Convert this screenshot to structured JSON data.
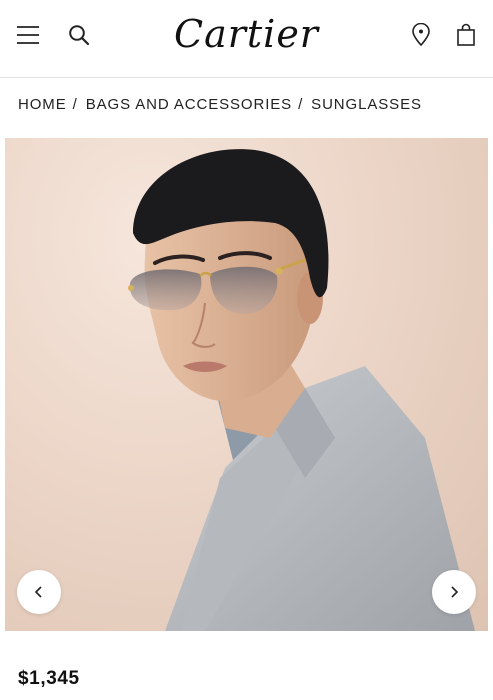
{
  "header": {
    "logo_text": "Cartier",
    "icons": [
      "menu-icon",
      "search-icon",
      "location-pin-icon",
      "shopping-bag-icon"
    ]
  },
  "breadcrumb": {
    "items": [
      "HOME",
      "BAGS AND ACCESSORIES",
      "SUNGLASSES"
    ],
    "separator": "/"
  },
  "gallery": {
    "controls": [
      "chevron-left-icon",
      "chevron-right-icon"
    ]
  },
  "product": {
    "price": "$1,345"
  },
  "colors": {
    "background": "#ffffff",
    "text": "#1a1a1a",
    "photo_backdrop": "#ecd6c8",
    "divider": "#e4e4e4"
  }
}
